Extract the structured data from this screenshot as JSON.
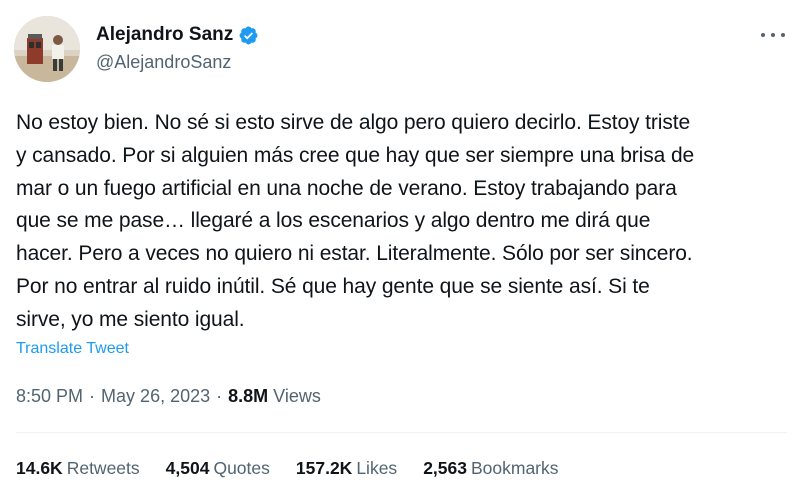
{
  "author": {
    "display_name": "Alejandro Sanz",
    "handle": "@AlejandroSanz",
    "verified": true,
    "verified_color": "#1d9bf0"
  },
  "tweet": {
    "text": "No estoy bien. No sé si esto sirve de algo pero quiero decirlo. Estoy triste\ny cansado. Por si alguien más cree que hay que ser siempre una brisa de\nmar o un fuego artificial en una noche de verano. Estoy trabajando para\nque se me pase… llegaré a los escenarios y algo dentro me dirá que\nhacer. Pero a veces no quiero ni estar. Literalmente. Sólo por ser sincero.\nPor no entrar al ruido inútil. Sé que hay gente que se siente así. Si te\nsirve, yo me siento igual.",
    "translate_label": "Translate Tweet",
    "time": "8:50 PM",
    "date": "May 26, 2023",
    "separator": "·",
    "views_count": "8.8M",
    "views_label": "Views"
  },
  "stats": {
    "retweets_count": "14.6K",
    "retweets_label": "Retweets",
    "quotes_count": "4,504",
    "quotes_label": "Quotes",
    "likes_count": "157.2K",
    "likes_label": "Likes",
    "bookmarks_count": "2,563",
    "bookmarks_label": "Bookmarks"
  },
  "colors": {
    "text_primary": "#0f1419",
    "text_secondary": "#536471",
    "link": "#1d9bf0",
    "divider": "#eff3f4"
  },
  "icons": {
    "more": "more-options-icon",
    "verified": "verified-badge-icon"
  }
}
